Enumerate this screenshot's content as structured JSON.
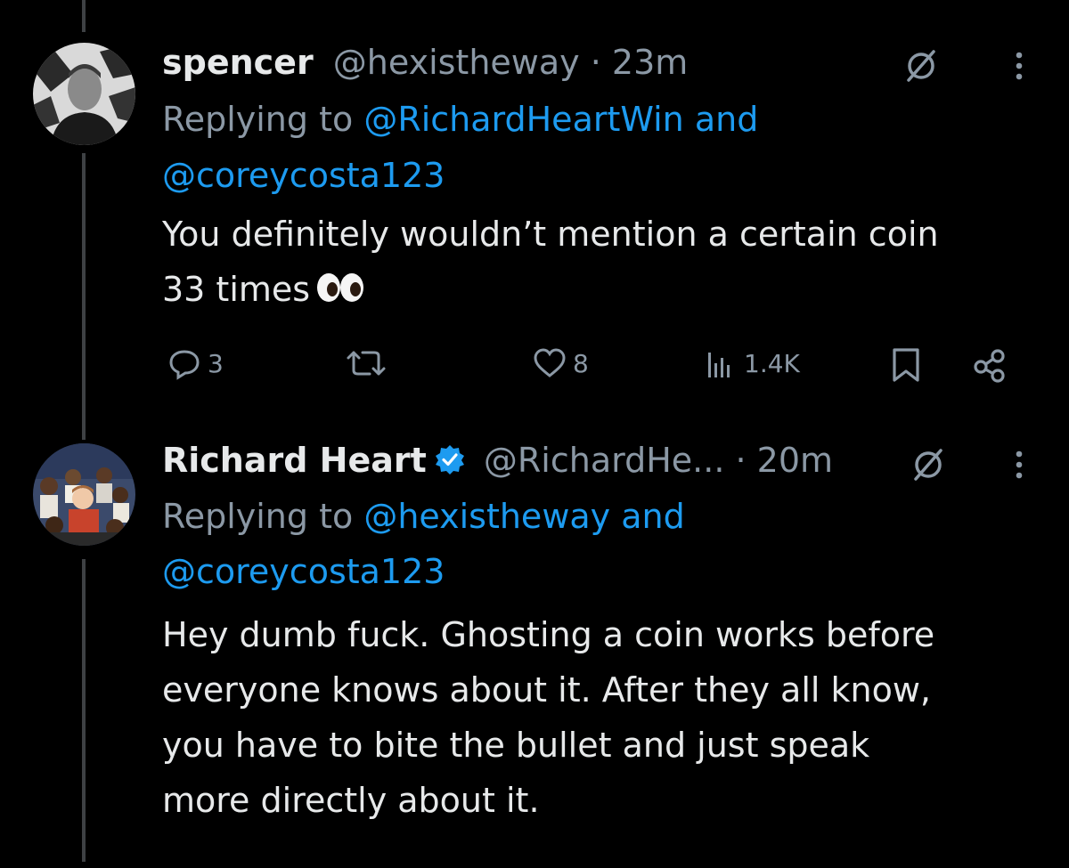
{
  "tweets": [
    {
      "name": "spencer",
      "handle": "@hexistheway",
      "time_sep": " · ",
      "time": "23m",
      "replying_prefix": "Replying to ",
      "reply_to_1": "@RichardHeartWin",
      "reply_and": " and",
      "reply_to_2": "@coreycosta123",
      "body_line1": "You definitely wouldn’t mention a certain coin",
      "body_line2": "33 times",
      "replies": "3",
      "retweets": "",
      "likes": "8",
      "views": "1.4K",
      "icons": [
        "grok-icon",
        "more-icon",
        "reply-icon",
        "retweet-icon",
        "like-icon",
        "views-icon",
        "bookmark-icon",
        "share-icon",
        "eyes-emoji"
      ]
    },
    {
      "name": "Richard Heart",
      "handle": "@RichardHe...",
      "time_sep": " · ",
      "time": "20m",
      "replying_prefix": "Replying to ",
      "reply_to_1": "@hexistheway",
      "reply_and": " and",
      "reply_to_2": "@coreycosta123",
      "body_lines": [
        "Hey dumb fuck. Ghosting a coin works before",
        "everyone knows about it. After they all know,",
        "you have to bite the bullet and just speak",
        "more directly about it."
      ],
      "icons": [
        "verified-badge-icon",
        "grok-icon",
        "more-icon"
      ]
    }
  ],
  "colors": {
    "background": "#000000",
    "text": "#e7e9ea",
    "muted": "#8b98a5",
    "link": "#1d9bf0",
    "thread_line": "#3e4144"
  }
}
